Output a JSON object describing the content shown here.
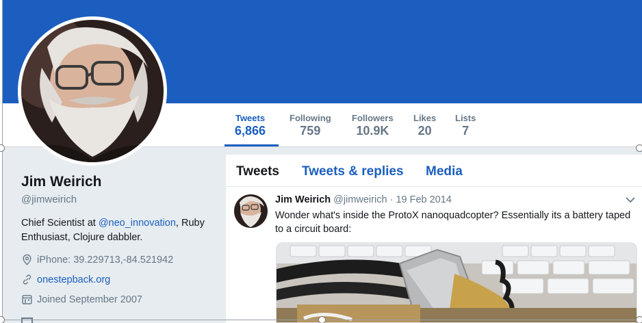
{
  "profile": {
    "name": "Jim Weirich",
    "handle": "@jimweirich",
    "bio_prefix": "Chief Scientist at ",
    "bio_link": "@neo_innovation",
    "bio_suffix": ", Ruby Enthusiast, Clojure dabbler.",
    "location": "iPhone: 39.229713,-84.521942",
    "website": "onestepback.org",
    "joined": "Joined September 2007"
  },
  "stats": [
    {
      "label": "Tweets",
      "value": "6,866",
      "active": true
    },
    {
      "label": "Following",
      "value": "759",
      "active": false
    },
    {
      "label": "Followers",
      "value": "10.9K",
      "active": false
    },
    {
      "label": "Likes",
      "value": "20",
      "active": false
    },
    {
      "label": "Lists",
      "value": "7",
      "active": false
    }
  ],
  "tabs": [
    {
      "label": "Tweets",
      "active": true
    },
    {
      "label": "Tweets & replies",
      "active": false
    },
    {
      "label": "Media",
      "active": false
    }
  ],
  "tweet": {
    "name": "Jim Weirich",
    "handle": "@jimweirich",
    "separator": "·",
    "date": "19 Feb 2014",
    "text": "Wonder what's inside the ProtoX nanoquadcopter?  Essentially its a battery taped to a circuit board:"
  },
  "icons": {
    "location": "map-pin-icon",
    "website": "link-icon",
    "joined": "calendar-icon",
    "caret": "chevron-down-icon"
  },
  "colors": {
    "brand": "#1b5ebf",
    "panel_bg": "#e6ecf0",
    "muted_text": "#657786"
  }
}
